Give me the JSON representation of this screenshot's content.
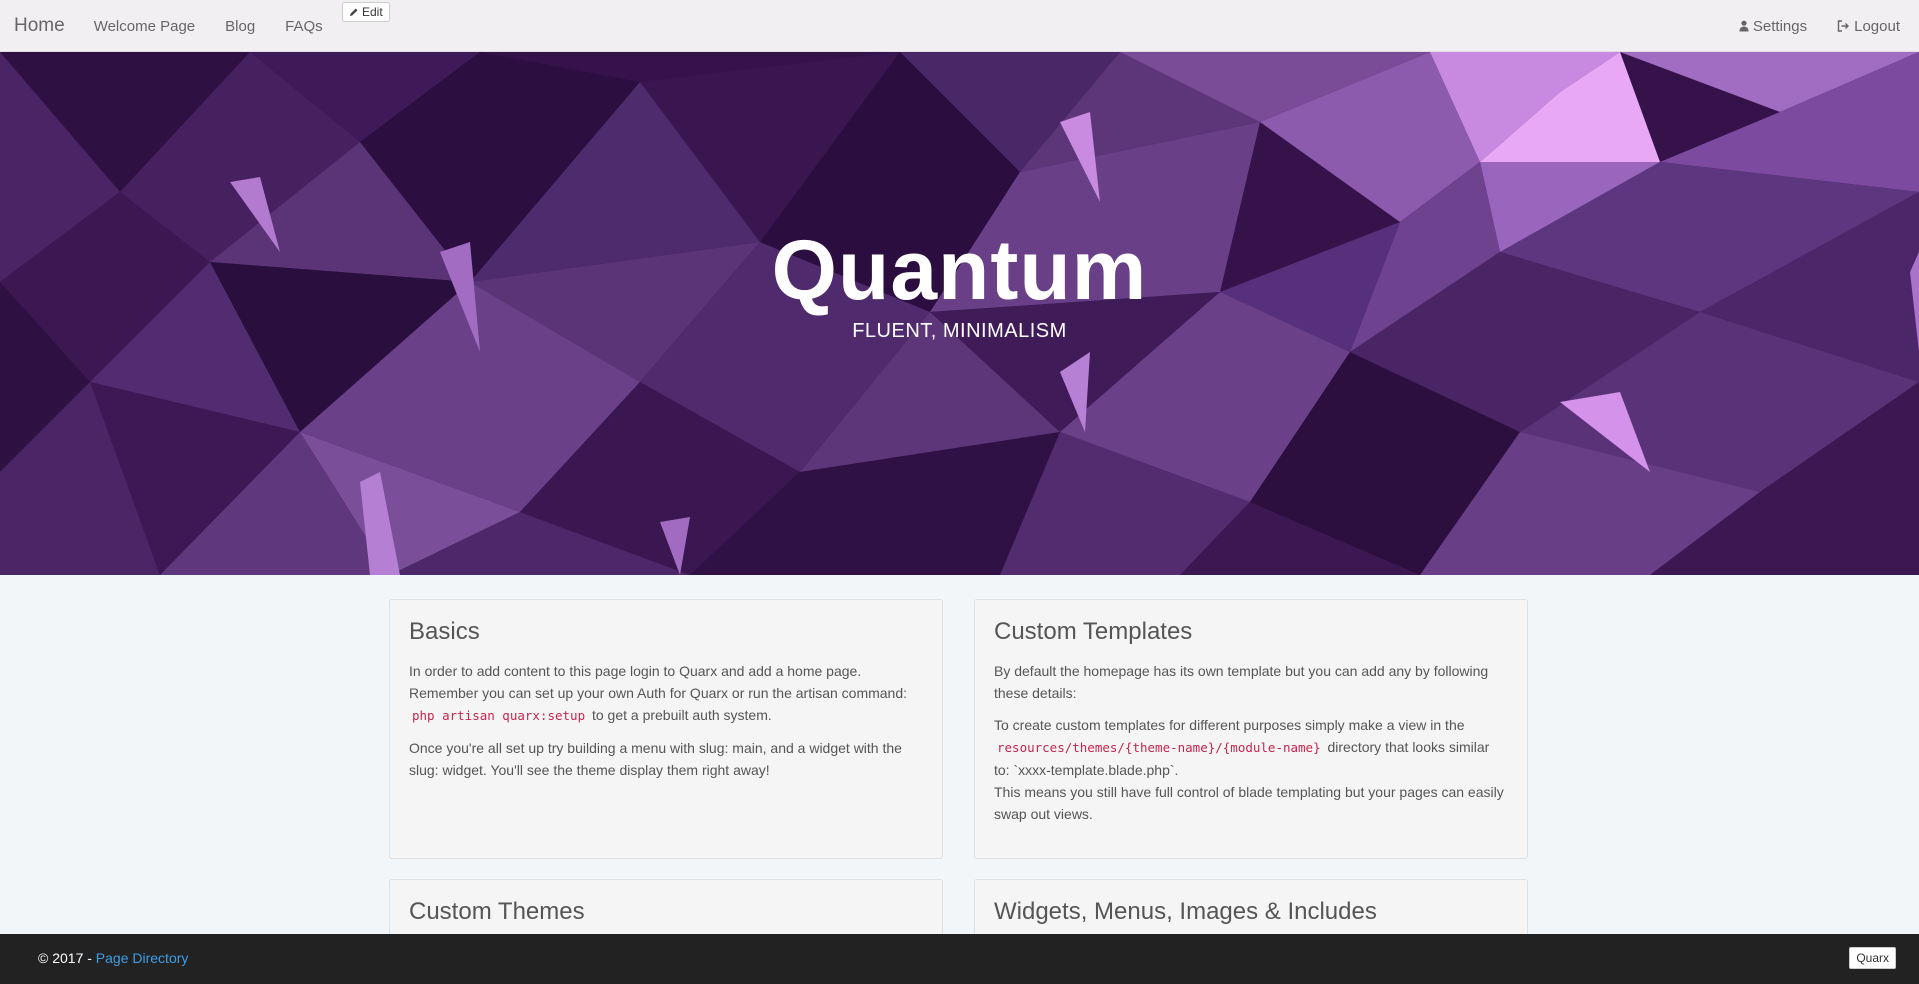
{
  "navbar": {
    "brand": "Home",
    "links": [
      {
        "label": "Welcome Page"
      },
      {
        "label": "Blog"
      },
      {
        "label": "FAQs"
      }
    ],
    "edit_label": "Edit",
    "settings_label": "Settings",
    "logout_label": "Logout"
  },
  "hero": {
    "title": "Quantum",
    "subtitle": "FLUENT, MINIMALISM"
  },
  "cards": {
    "basics": {
      "title": "Basics",
      "p1_a": "In order to add content to this page login to Quarx and add a home page. Remember you can set up your own Auth for Quarx or run the artisan command: ",
      "p1_code": "php artisan quarx:setup",
      "p1_b": " to get a prebuilt auth system.",
      "p2": "Once you're all set up try building a menu with slug: main, and a widget with the slug: widget. You'll see the theme display them right away!"
    },
    "custom_templates": {
      "title": "Custom Templates",
      "p1": "By default the homepage has its own template but you can add any by following these details:",
      "p2_a": "To create custom templates for different purposes simply make a view in the ",
      "p2_code": "resources/themes/{theme-name}/{module-name}",
      "p2_b": " directory that looks similar to: `xxxx-template.blade.php`.",
      "p2_c": "This means you still have full control of blade templating but your pages can easily swap out views."
    },
    "custom_themes": {
      "title": "Custom Themes"
    },
    "widgets": {
      "title": "Widgets, Menus, Images & Includes"
    }
  },
  "footer": {
    "copyright": "© 2017 - ",
    "link_label": "Page Directory",
    "quarx_label": "Quarx"
  },
  "colors": {
    "hero_base": "#3a1650",
    "link": "#3d9ee8",
    "code": "#c7254e",
    "footer_bg": "#222222"
  }
}
